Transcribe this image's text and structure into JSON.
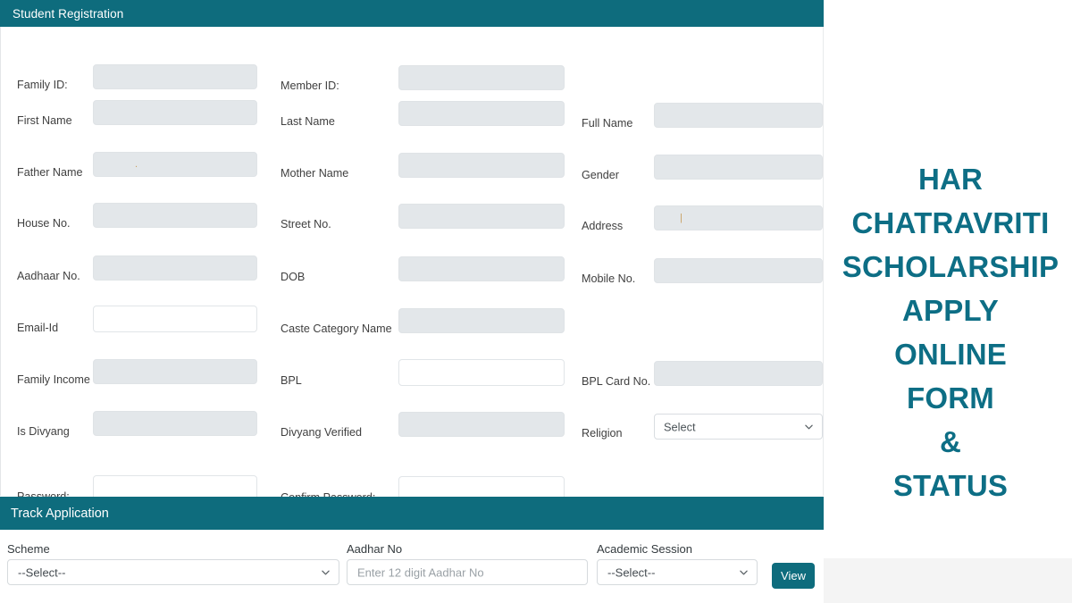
{
  "registration": {
    "title": "Student Registration",
    "rows": [
      {
        "fields": [
          {
            "label": "Family ID:",
            "type": "disabled",
            "value": ""
          },
          {
            "label": "Member ID:",
            "type": "disabled",
            "value": ""
          }
        ]
      },
      {
        "fields": [
          {
            "label": "First Name",
            "type": "disabled",
            "value": ""
          },
          {
            "label": "Last Name",
            "type": "disabled",
            "value": ""
          },
          {
            "label": "Full Name",
            "type": "disabled",
            "value": ""
          }
        ]
      },
      {
        "fields": [
          {
            "label": "Father Name",
            "type": "disabled",
            "value": ""
          },
          {
            "label": "Mother Name",
            "type": "disabled",
            "value": ""
          },
          {
            "label": "Gender",
            "type": "disabled",
            "value": ""
          }
        ]
      },
      {
        "fields": [
          {
            "label": "House No.",
            "type": "disabled",
            "value": ""
          },
          {
            "label": "Street No.",
            "type": "disabled",
            "value": ""
          },
          {
            "label": "Address",
            "type": "disabled",
            "value": ""
          }
        ]
      },
      {
        "fields": [
          {
            "label": "Aadhaar No.",
            "type": "disabled",
            "value": ""
          },
          {
            "label": "DOB",
            "type": "disabled",
            "value": ""
          },
          {
            "label": "Mobile No.",
            "type": "disabled",
            "value": ""
          }
        ]
      },
      {
        "fields": [
          {
            "label": "Email-Id",
            "type": "editable",
            "value": ""
          },
          {
            "label": "Caste Category Name",
            "type": "disabled",
            "value": ""
          }
        ]
      },
      {
        "fields": [
          {
            "label": "Family Income",
            "type": "disabled",
            "value": ""
          },
          {
            "label": "BPL",
            "type": "editable",
            "value": ""
          },
          {
            "label": "BPL Card No.",
            "type": "disabled",
            "value": ""
          }
        ]
      },
      {
        "fields": [
          {
            "label": "Is Divyang",
            "type": "disabled",
            "value": ""
          },
          {
            "label": "Divyang Verified",
            "type": "disabled",
            "value": ""
          },
          {
            "label": "Religion",
            "type": "select",
            "value": "Select"
          }
        ]
      },
      {
        "fields": [
          {
            "label": "Password:",
            "type": "editable",
            "value": ""
          },
          {
            "label": "Confirm Password:",
            "type": "editable",
            "value": ""
          }
        ]
      }
    ]
  },
  "track": {
    "title": "Track Application",
    "scheme": {
      "label": "Scheme",
      "value": "--Select--"
    },
    "aadhar": {
      "label": "Aadhar No",
      "placeholder": "Enter 12 digit Aadhar No",
      "value": ""
    },
    "session": {
      "label": "Academic Session",
      "value": "--Select--"
    },
    "view_button": "View"
  },
  "promo": {
    "lines": [
      "HAR",
      "CHATRAVRITI",
      "SCHOLARSHIP",
      "APPLY",
      "ONLINE",
      "FORM",
      "&",
      "STATUS"
    ],
    "color": "#0d6e85"
  },
  "theme": {
    "header_teal": "#0e6c7d",
    "disabled_field": "#e3e7ea",
    "gray_panel": "#f4f4f4"
  }
}
